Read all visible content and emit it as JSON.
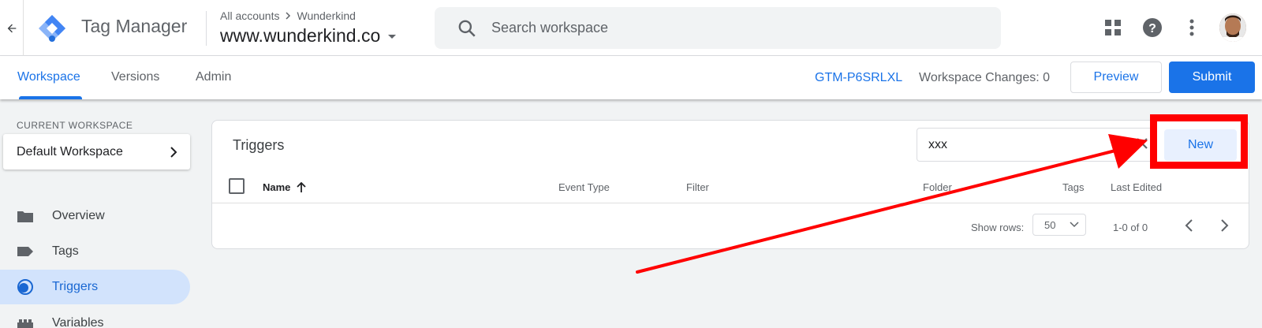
{
  "header": {
    "app_title": "Tag Manager",
    "breadcrumb_root": "All accounts",
    "breadcrumb_account": "Wunderkind",
    "container_name": "www.wunderkind.co",
    "search_placeholder": "Search workspace",
    "icons": [
      "arrow-left-icon",
      "tag-manager-logo",
      "search-icon",
      "apps-icon",
      "help-icon",
      "more-vert-icon",
      "avatar"
    ]
  },
  "nav": {
    "tabs": [
      {
        "label": "Workspace",
        "active": true
      },
      {
        "label": "Versions",
        "active": false
      },
      {
        "label": "Admin",
        "active": false
      }
    ],
    "container_id": "GTM-P6SRLXL",
    "workspace_changes": "Workspace Changes: 0",
    "preview_label": "Preview",
    "submit_label": "Submit"
  },
  "sidebar": {
    "current_workspace_label": "CURRENT WORKSPACE",
    "workspace_name": "Default Workspace",
    "items": [
      {
        "label": "Overview",
        "icon": "folder-icon",
        "active": false
      },
      {
        "label": "Tags",
        "icon": "tag-icon",
        "active": false
      },
      {
        "label": "Triggers",
        "icon": "trigger-icon",
        "active": true
      },
      {
        "label": "Variables",
        "icon": "variables-icon",
        "active": false
      }
    ]
  },
  "triggers": {
    "title": "Triggers",
    "filter_value": "xxx",
    "new_label": "New",
    "columns": [
      "Name",
      "Event Type",
      "Filter",
      "Folder",
      "Tags",
      "Last Edited"
    ],
    "rows": [],
    "show_rows_label": "Show rows:",
    "rows_per_page": "50",
    "range": "1-0 of 0"
  },
  "colors": {
    "accent": "#1a73e8",
    "active_bg": "#d2e3fc",
    "annotation": "#ff0000"
  }
}
